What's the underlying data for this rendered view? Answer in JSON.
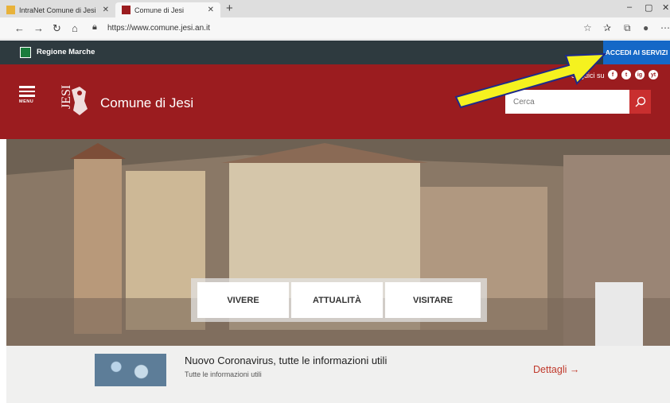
{
  "browser": {
    "tabs": [
      {
        "label": "IntraNet Comune di Jesi",
        "active": false
      },
      {
        "label": "Comune di Jesi",
        "active": true
      }
    ],
    "new_tab": "+",
    "url": "https://www.comune.jesi.an.it",
    "window_controls": [
      "–",
      "▢",
      "✕"
    ]
  },
  "region_bar": {
    "name": "Regione Marche",
    "login_button": "ACCEDI AI SERVIZI"
  },
  "header": {
    "menu_label": "MENU",
    "emblem_text": "JESI",
    "site_title": "Comune di Jesi",
    "follow_text": "Seguici su",
    "social": [
      "f",
      "t",
      "ig",
      "yt"
    ],
    "search_placeholder": "Cerca",
    "accent_color": "#9b1c1f"
  },
  "hero": {
    "buttons": [
      "VIVERE",
      "ATTUALITÀ",
      "VISITARE"
    ]
  },
  "news": {
    "title": "Nuovo Coronavirus, tutte le informazioni utili",
    "subtitle": "Tutte le informazioni utili",
    "link": "Dettagli →"
  }
}
